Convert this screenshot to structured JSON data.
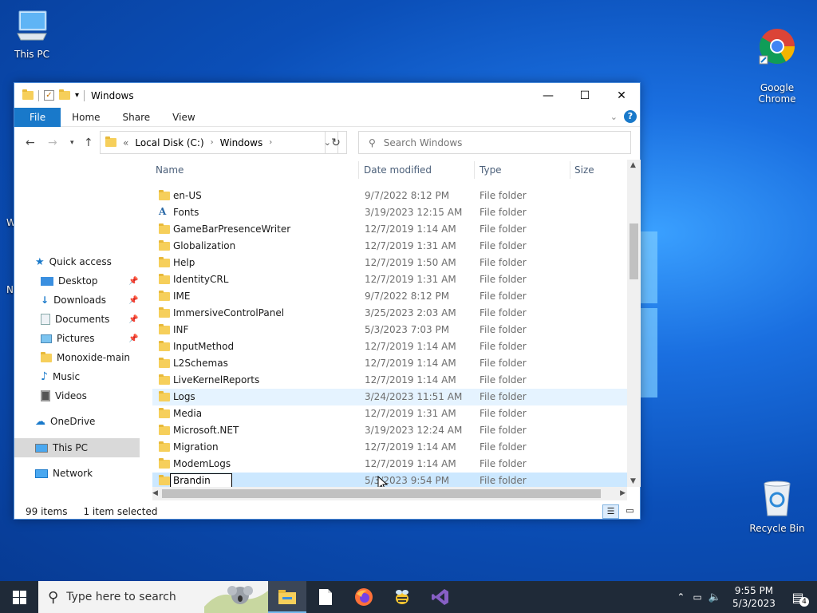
{
  "desktop": {
    "icons": [
      {
        "label": "This PC"
      },
      {
        "label": "Google\nChrome"
      },
      {
        "label": "Recycle Bin"
      }
    ]
  },
  "explorer": {
    "title": "Windows",
    "ribbon": {
      "file": "File",
      "home": "Home",
      "share": "Share",
      "view": "View"
    },
    "address": {
      "chevrons": "«",
      "crumbs": [
        "Local Disk (C:)",
        "Windows"
      ]
    },
    "search": {
      "placeholder": "Search Windows"
    },
    "nav": {
      "items": [
        {
          "label": "Quick access"
        },
        {
          "label": "Desktop"
        },
        {
          "label": "Downloads"
        },
        {
          "label": "Documents"
        },
        {
          "label": "Pictures"
        },
        {
          "label": "Monoxide-main"
        },
        {
          "label": "Music"
        },
        {
          "label": "Videos"
        },
        {
          "label": "OneDrive"
        },
        {
          "label": "This PC"
        },
        {
          "label": "Network"
        }
      ]
    },
    "columns": {
      "name": "Name",
      "date": "Date modified",
      "type": "Type",
      "size": "Size"
    },
    "rows": [
      {
        "name": "en-US",
        "date": "9/7/2022 8:12 PM",
        "type": "File folder"
      },
      {
        "name": "Fonts",
        "date": "3/19/2023 12:15 AM",
        "type": "File folder"
      },
      {
        "name": "GameBarPresenceWriter",
        "date": "12/7/2019 1:14 AM",
        "type": "File folder"
      },
      {
        "name": "Globalization",
        "date": "12/7/2019 1:31 AM",
        "type": "File folder"
      },
      {
        "name": "Help",
        "date": "12/7/2019 1:50 AM",
        "type": "File folder"
      },
      {
        "name": "IdentityCRL",
        "date": "12/7/2019 1:31 AM",
        "type": "File folder"
      },
      {
        "name": "IME",
        "date": "9/7/2022 8:12 PM",
        "type": "File folder"
      },
      {
        "name": "ImmersiveControlPanel",
        "date": "3/25/2023 2:03 AM",
        "type": "File folder"
      },
      {
        "name": "INF",
        "date": "5/3/2023 7:03 PM",
        "type": "File folder"
      },
      {
        "name": "InputMethod",
        "date": "12/7/2019 1:14 AM",
        "type": "File folder"
      },
      {
        "name": "L2Schemas",
        "date": "12/7/2019 1:14 AM",
        "type": "File folder"
      },
      {
        "name": "LiveKernelReports",
        "date": "12/7/2019 1:14 AM",
        "type": "File folder"
      },
      {
        "name": "Logs",
        "date": "3/24/2023 11:51 AM",
        "type": "File folder"
      },
      {
        "name": "Media",
        "date": "12/7/2019 1:31 AM",
        "type": "File folder"
      },
      {
        "name": "Microsoft.NET",
        "date": "3/19/2023 12:24 AM",
        "type": "File folder"
      },
      {
        "name": "Migration",
        "date": "12/7/2019 1:14 AM",
        "type": "File folder"
      },
      {
        "name": "ModemLogs",
        "date": "12/7/2019 1:14 AM",
        "type": "File folder"
      },
      {
        "name": "Brandin",
        "date": "5/3/2023 9:54 PM",
        "type": "File folder"
      }
    ],
    "status": {
      "count": "99 items",
      "selected": "1 item selected"
    }
  },
  "taskbar": {
    "search_placeholder": "Type here to search",
    "time": "9:55 PM",
    "date": "5/3/2023",
    "notifications": "4"
  }
}
